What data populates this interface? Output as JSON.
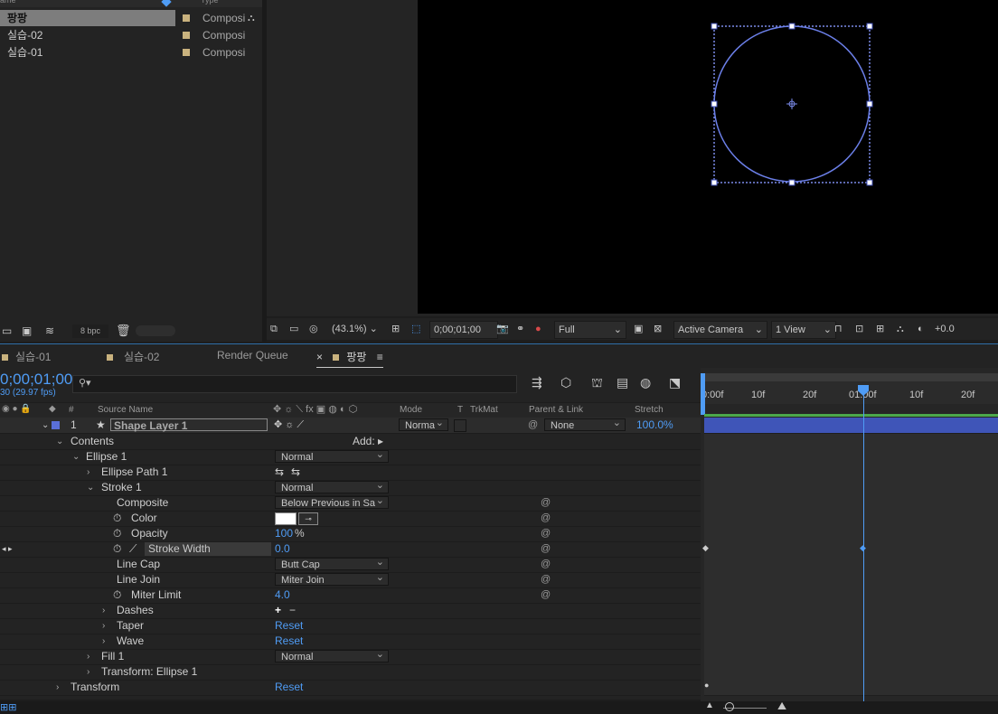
{
  "project": {
    "header_name": "ame",
    "header_type": "Type",
    "items": [
      {
        "name": "팡팡",
        "type": "Composi",
        "selected": true
      },
      {
        "name": "실습-02",
        "type": "Composi",
        "selected": false
      },
      {
        "name": "실습-01",
        "type": "Composi",
        "selected": false
      }
    ],
    "bpc": "8 bpc"
  },
  "viewer_bar": {
    "zoom": "(43.1%)",
    "timecode": "0;00;01;00",
    "resolution": "Full",
    "camera": "Active Camera",
    "views": "1 View",
    "exposure": "+0.0"
  },
  "timeline_tabs": [
    {
      "label": "실습-01"
    },
    {
      "label": "실습-02"
    },
    {
      "label": "Render Queue"
    },
    {
      "label": "팡팡",
      "active": true
    }
  ],
  "timeline": {
    "timecode": "0;00;01;00",
    "fps": "30 (29.97 fps)",
    "search_placeholder": "",
    "columns": {
      "number": "#",
      "source_name": "Source Name",
      "mode": "Mode",
      "t": "T",
      "trkmat": "TrkMat",
      "parent": "Parent & Link",
      "stretch": "Stretch"
    },
    "layer": {
      "number": "1",
      "name": "Shape Layer 1",
      "mode": "Norma",
      "parent": "None",
      "stretch": "100.0%"
    },
    "add_label": "Add:",
    "props": {
      "contents": "Contents",
      "ellipse1": "Ellipse 1",
      "ellipse1_mode": "Normal",
      "ellipse_path": "Ellipse Path 1",
      "stroke1": "Stroke 1",
      "stroke1_mode": "Normal",
      "composite": "Composite",
      "composite_val": "Below Previous in Sa",
      "color": "Color",
      "opacity": "Opacity",
      "opacity_val": "100",
      "opacity_unit": "%",
      "stroke_width": "Stroke Width",
      "stroke_width_val": "0.0",
      "line_cap": "Line Cap",
      "line_cap_val": "Butt Cap",
      "line_join": "Line Join",
      "line_join_val": "Miter Join",
      "miter_limit": "Miter Limit",
      "miter_limit_val": "4.0",
      "dashes": "Dashes",
      "taper": "Taper",
      "taper_val": "Reset",
      "wave": "Wave",
      "wave_val": "Reset",
      "fill1": "Fill 1",
      "fill1_mode": "Normal",
      "transform_ellipse": "Transform: Ellipse 1",
      "transform": "Transform",
      "transform_val": "Reset"
    },
    "ruler": [
      "0:00f",
      "10f",
      "20f",
      "01:00f",
      "10f",
      "20f"
    ]
  },
  "colors": {
    "accent": "#4f9cf5",
    "layer_bar": "#3f55b8",
    "shape_stroke": "#6b7fe8",
    "label_swatch": "#c9b27e"
  }
}
